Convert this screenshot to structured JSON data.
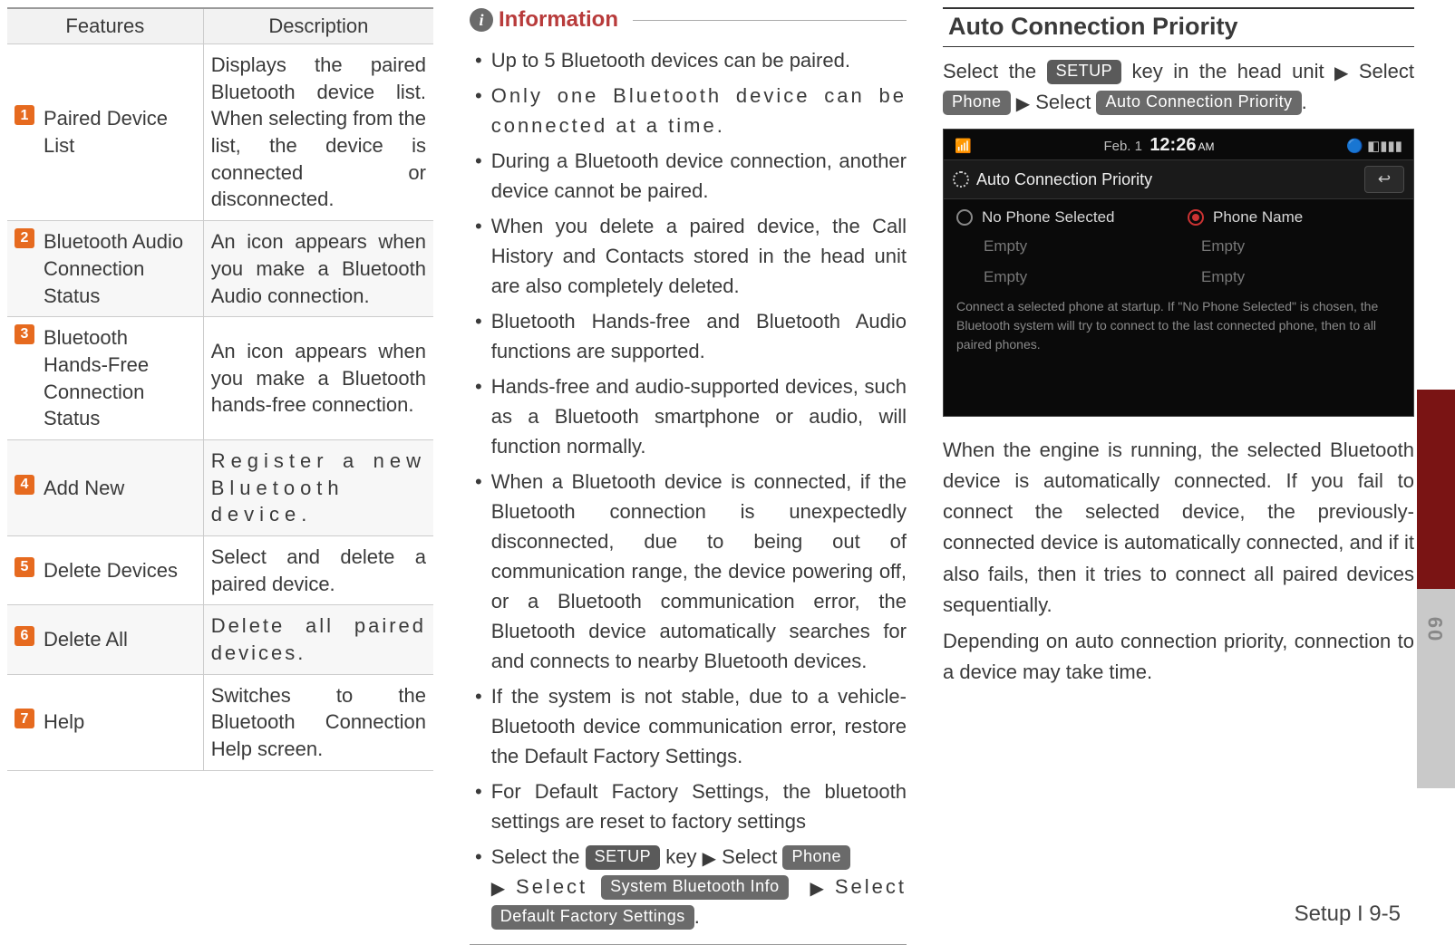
{
  "table": {
    "head_features": "Features",
    "head_description": "Description",
    "rows": [
      {
        "n": "1",
        "f": "Paired Device List",
        "d": "Displays the paired Bluetooth device list. When selecting from the list, the device is connected or disconnected."
      },
      {
        "n": "2",
        "f": "Bluetooth Audio Connection Status",
        "d": "An icon appears when you make a Bluetooth Audio connection."
      },
      {
        "n": "3",
        "f": "Bluetooth Hands-Free Connection Status",
        "d": "An icon appears when you make a Bluetooth hands-free connection."
      },
      {
        "n": "4",
        "f": "Add New",
        "d": "Register a new Bluetooth device."
      },
      {
        "n": "5",
        "f": "Delete Devices",
        "d": "Select and delete a paired device."
      },
      {
        "n": "6",
        "f": "Delete All",
        "d": "Delete all paired devices."
      },
      {
        "n": "7",
        "f": "Help",
        "d": "Switches to the Bluetooth Connection Help screen."
      }
    ]
  },
  "info": {
    "title": "Information",
    "items": [
      "Up to 5 Bluetooth devices can be paired.",
      "Only one Bluetooth device can be connected at a time.",
      "During a Bluetooth device connection, another device cannot be paired.",
      "When you delete a paired device, the Call History and Contacts stored in the head unit are also completely deleted.",
      "Bluetooth Hands-free and Bluetooth Audio functions are supported.",
      "Hands-free and audio-supported devices, such as a Bluetooth smartphone or audio, will function normally.",
      "When a Bluetooth device is connected, if the Bluetooth connection is unexpectedly disconnected, due to being out of communication range, the device powering off, or a Bluetooth communication error, the Bluetooth device automatically searches for and connects to nearby Bluetooth devices.",
      "If the system is not stable, due to a vehicle-Bluetooth device communication error, restore the Default Factory Settings.",
      "For Default Factory Settings, the bluetooth settings are reset to factory settings"
    ],
    "last": {
      "pre": "Select the ",
      "key": " key ",
      "sel1": " Select ",
      "sel2": "Select ",
      "sel3": "Select "
    }
  },
  "buttons": {
    "setup": "SETUP",
    "phone": "Phone",
    "sys_bt_info": "System Bluetooth Info",
    "default_factory": "Default Factory Settings",
    "auto_conn_priority": "Auto Connection Priority"
  },
  "section3": {
    "heading": "Auto Connection Priority",
    "nav_pre": "Select the ",
    "nav_mid": " key in the head unit ",
    "nav_sel1": "Select ",
    "nav_sel2": " Select ",
    "para1": "When the engine is running, the selected Bluetooth device is automatically connected. If you fail to connect the selected device, the previously-connected device is automatically connected, and if it also fails, then it tries to connect all paired devices sequentially.",
    "para2": "Depending on auto connection priority, connection to a device may take time."
  },
  "shot": {
    "date": "Feb. 1",
    "time": "12:26",
    "ampm": "AM",
    "title": "Auto Connection Priority",
    "opt_none": "No Phone Selected",
    "opt_name": "Phone Name",
    "empty": "Empty",
    "hint": "Connect a selected phone at startup. If \"No Phone Selected\" is chosen, the Bluetooth system will try to connect to the last connected phone, then to all paired phones."
  },
  "footer": "Setup I 9-5",
  "tab_num": "09"
}
